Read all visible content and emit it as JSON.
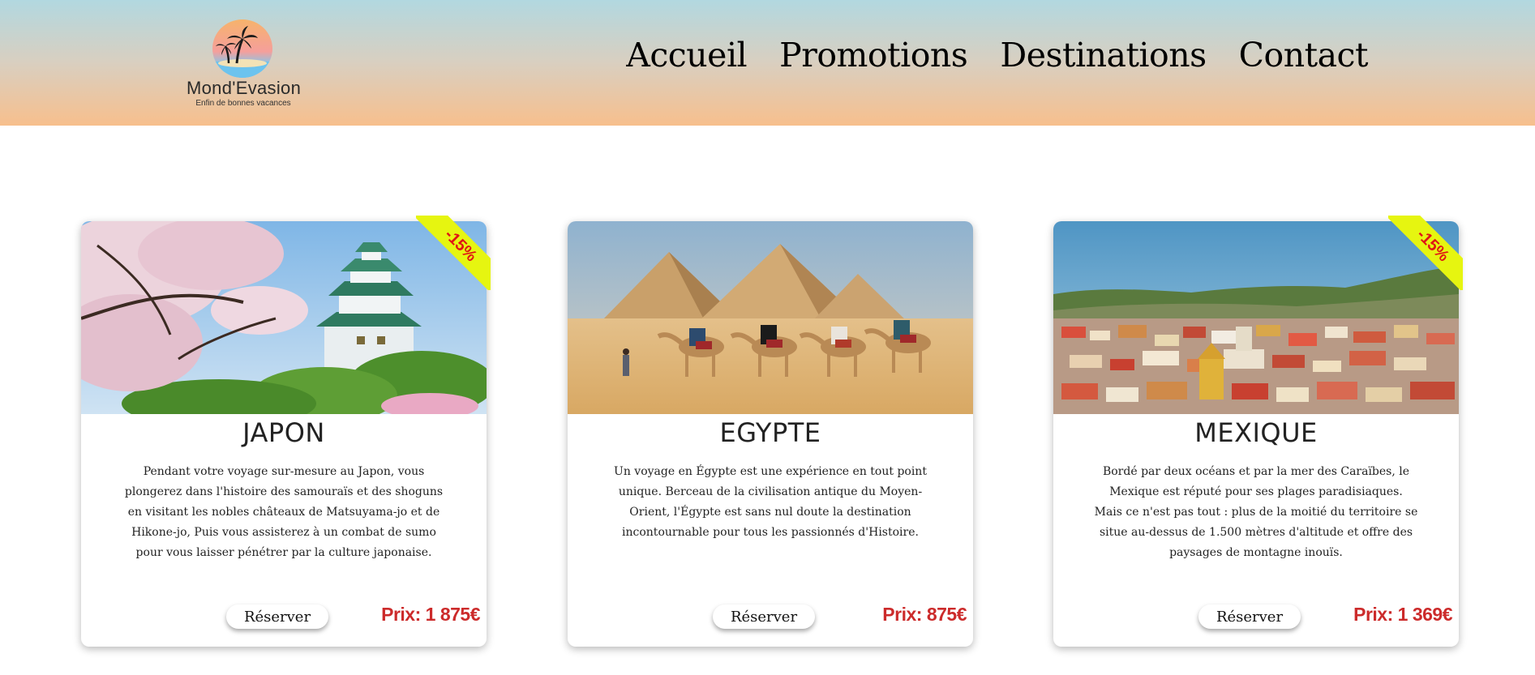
{
  "logo": {
    "name": "Mond'Evasion",
    "tagline": "Enfin de bonnes vacances"
  },
  "nav": [
    "Accueil",
    "Promotions",
    "Destinations",
    "Contact"
  ],
  "cards": [
    {
      "title": "JAPON",
      "badge": "-15%",
      "description": "Pendant votre voyage sur-mesure au Japon, vous plongerez dans l'histoire des samouraïs et des shoguns en visitant les nobles châteaux de Matsuyama-jo et de Hikone-jo, Puis vous assisterez à un combat de sumo pour vous laisser pénétrer par la culture japonaise.",
      "button": "Réserver",
      "price": "Prix: 1 875€"
    },
    {
      "title": "EGYPTE",
      "badge": "",
      "description": "Un voyage en Égypte est une expérience en tout point unique. Berceau de la civilisation antique du Moyen-Orient, l'Égypte est sans nul doute la destination incontournable pour tous les passionnés d'Histoire.",
      "button": "Réserver",
      "price": "Prix: 875€"
    },
    {
      "title": "MEXIQUE",
      "badge": "-15%",
      "description": "Bordé par deux océans et par la mer des Caraïbes, le Mexique est réputé pour ses plages paradisiaques. Mais ce n'est pas tout : plus de la moitié du territoire se situe au-dessus de 1.500 mètres d'altitude et offre des paysages de montagne inouïs.",
      "button": "Réserver",
      "price": "Prix: 1 369€"
    }
  ],
  "colors": {
    "price": "#cc2b2b",
    "badge_bg": "#e6f510",
    "badge_text": "#e01515"
  }
}
